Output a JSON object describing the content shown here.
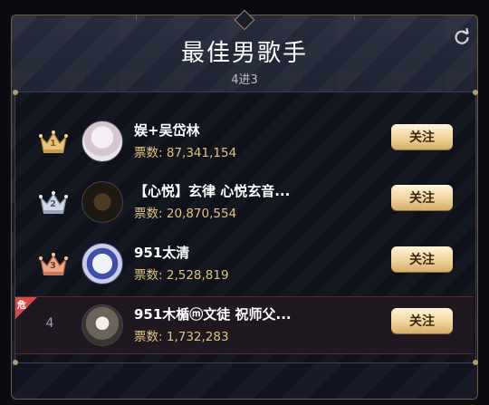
{
  "header": {
    "title": "最佳男歌手",
    "subtitle": "4进3",
    "refresh_icon": "refresh-icon"
  },
  "ranking": {
    "vote_prefix": "票数:",
    "follow_label": "关注",
    "items": [
      {
        "rank": "1",
        "rank_icon": "gold-crown-icon",
        "name": "娱+吴岱林",
        "votes": "87,341,154",
        "avatar_color": "#e8e0e6"
      },
      {
        "rank": "2",
        "rank_icon": "silver-crown-icon",
        "name": "【心悦】玄律 心悦玄音...",
        "votes": "20,870,554",
        "avatar_color": "#2a2318"
      },
      {
        "rank": "3",
        "rank_icon": "bronze-crown-icon",
        "name": "951太清",
        "votes": "2,528,819",
        "avatar_color": "#d8dcf0"
      },
      {
        "rank": "4",
        "rank_icon": "",
        "name": "951木楯ⓜ文徒 祝师父...",
        "votes": "1,732,283",
        "avatar_color": "#6a6258",
        "danger_label": "危"
      }
    ]
  },
  "colors": {
    "accent_gold": "#e2c27c",
    "danger": "#d94a4a",
    "frame_border": "#6e5a42"
  }
}
